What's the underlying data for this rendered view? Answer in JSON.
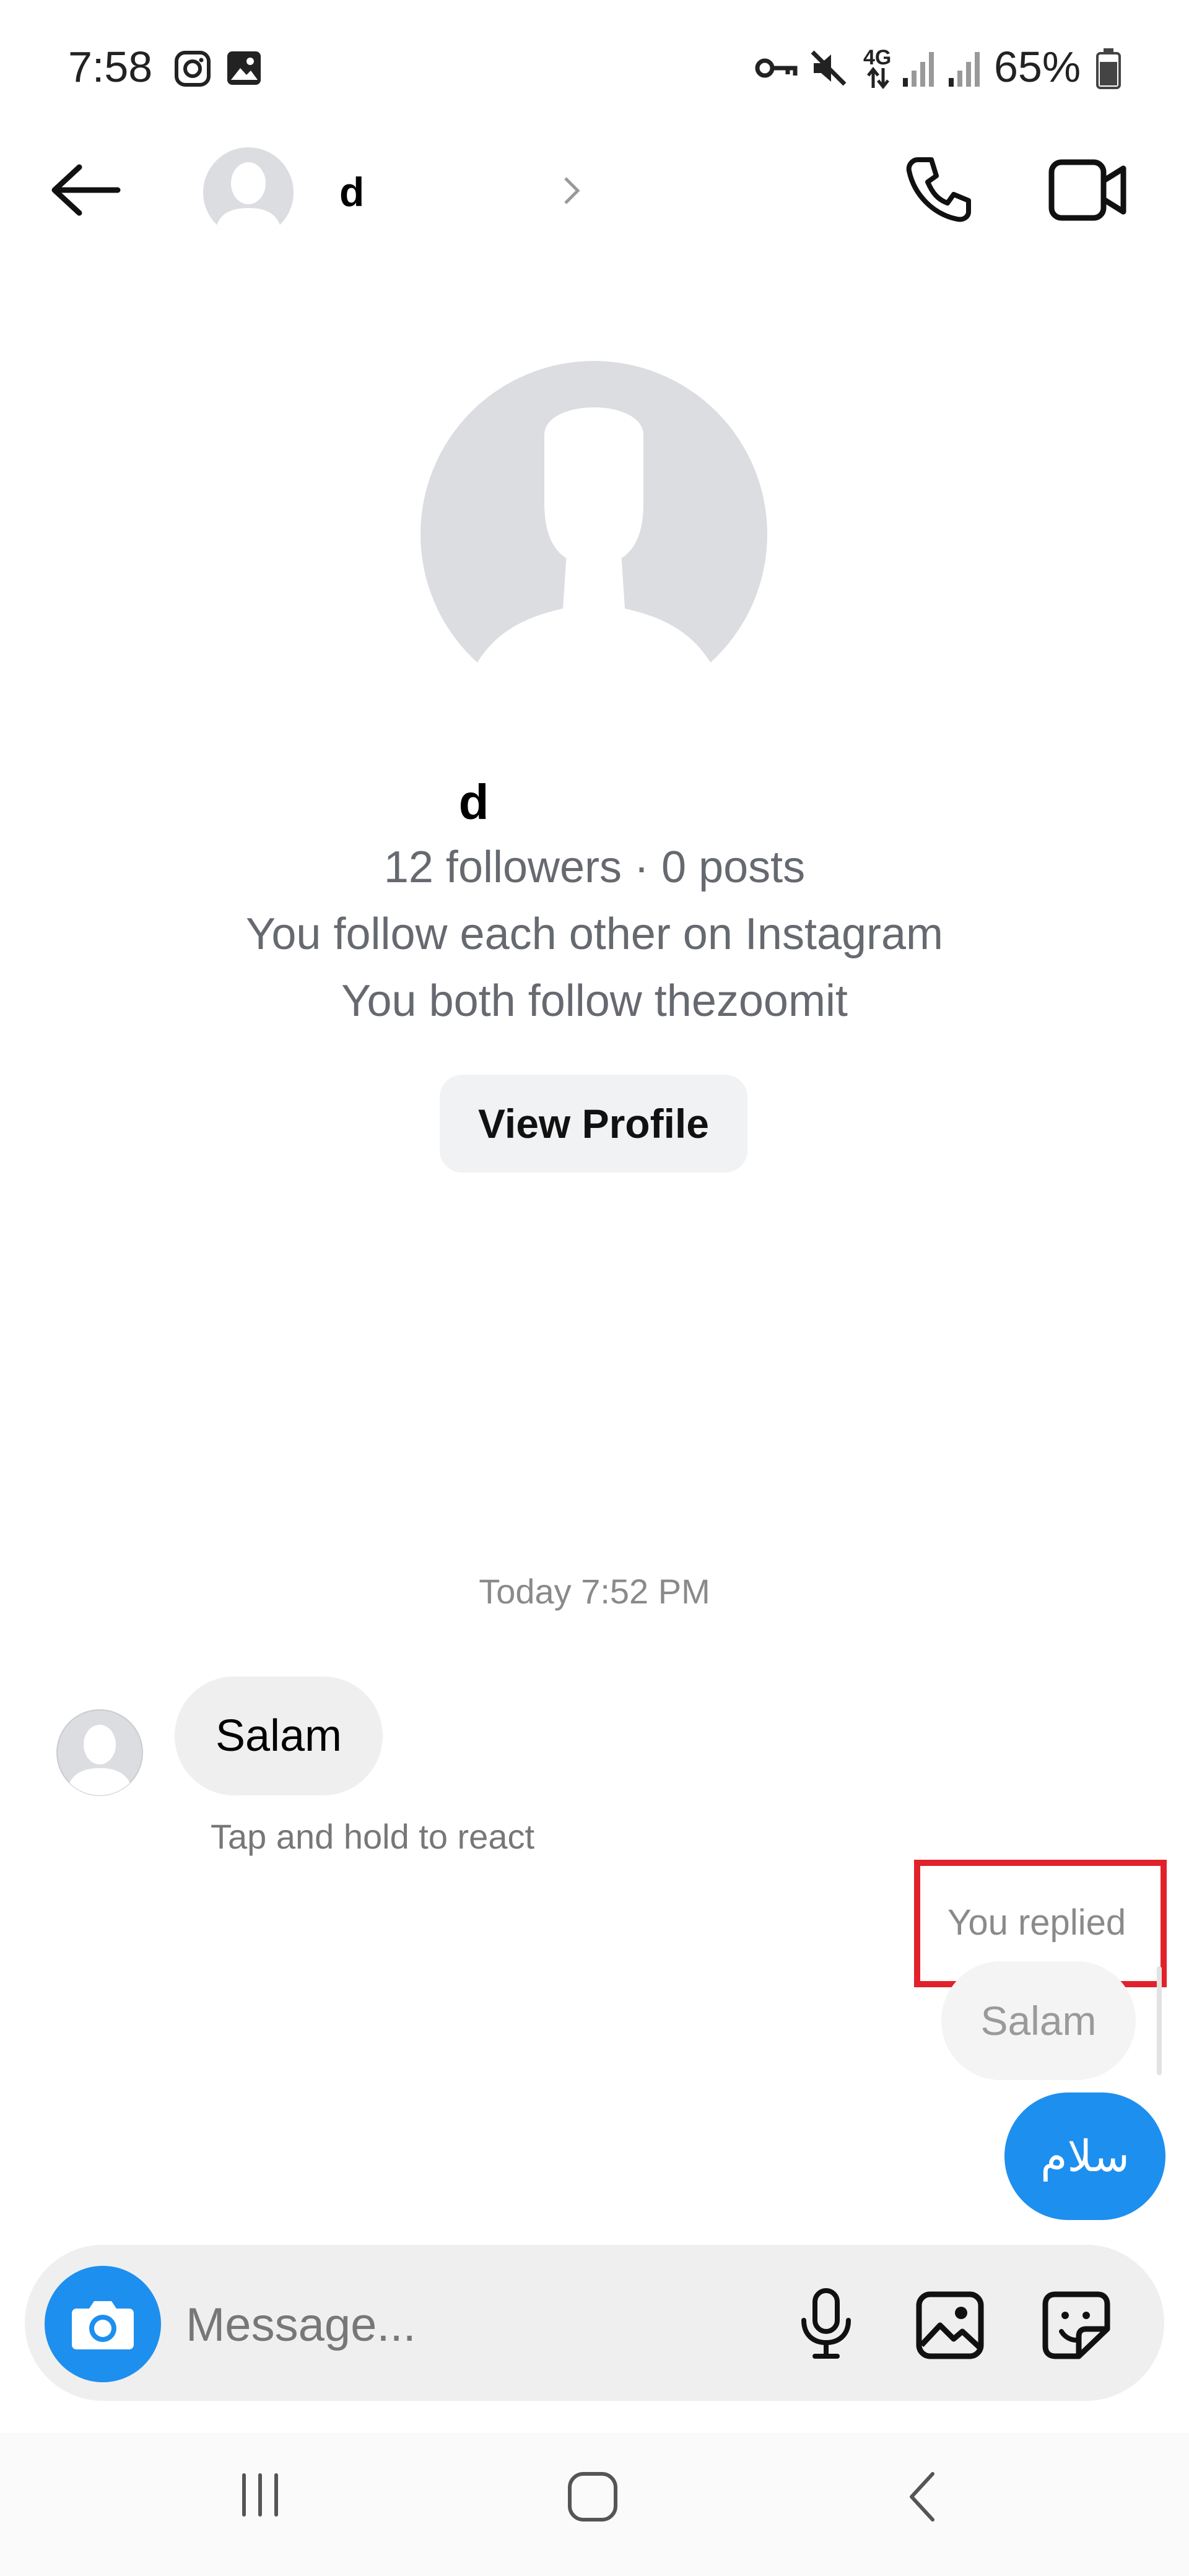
{
  "status_bar": {
    "time": "7:58",
    "battery": "65%",
    "network": "4G",
    "icons": [
      "instagram-icon",
      "gallery-icon",
      "vpn-key-icon",
      "mute-icon",
      "data-arrows-icon",
      "signal-icon",
      "signal-icon",
      "battery-icon"
    ]
  },
  "header": {
    "username": "d",
    "icons": [
      "back-arrow-icon",
      "avatar",
      "chevron-right-icon",
      "phone-icon",
      "video-icon"
    ]
  },
  "profile": {
    "name": "d",
    "stats": "12 followers · 0 posts",
    "mutual_follow": "You follow each other on Instagram",
    "mutual_accounts": "You both follow thezoomit",
    "view_profile_label": "View Profile"
  },
  "chat": {
    "timestamp": "Today 7:52 PM",
    "incoming_message": "Salam",
    "react_hint": "Tap and hold to react",
    "you_replied_label": "You replied",
    "quoted_message": "Salam",
    "outgoing_message": "سلام"
  },
  "composer": {
    "placeholder": "Message..."
  },
  "colors": {
    "accent": "#1d8fef",
    "highlight_box": "#e0222b",
    "bubble_grey": "#efefef"
  }
}
